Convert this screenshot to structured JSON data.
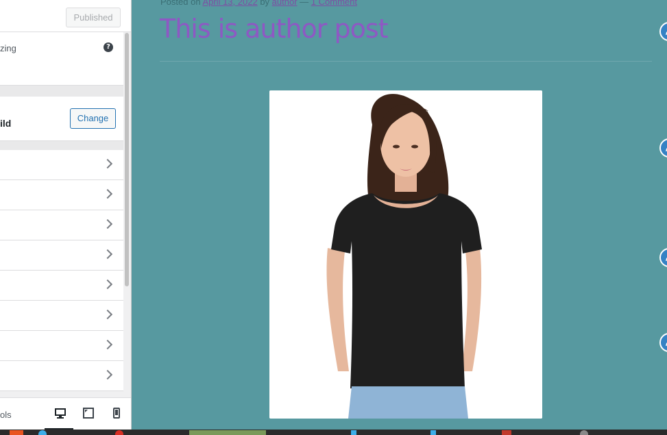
{
  "sidebar": {
    "header": {
      "published_label": "Published"
    },
    "info": {
      "text": "zing",
      "help_icon": "?"
    },
    "theme": {
      "name": "ild",
      "change_label": "Change"
    },
    "sections": [
      {},
      {},
      {},
      {},
      {},
      {},
      {},
      {}
    ],
    "footer": {
      "label": "ols"
    }
  },
  "preview": {
    "meta": {
      "prefix": "Posted on",
      "date": "April 13, 2022",
      "by": "by",
      "author": "author",
      "dash": "—",
      "comments": "1 Comment"
    },
    "title": "This is author post"
  },
  "colors": {
    "preview_background": "#5799a0",
    "title": "#8e58c4",
    "accent": "#2271b1",
    "edit_shortcut": "#3582c4"
  },
  "icons": {
    "desktop_preview": "desktop-icon",
    "tablet_preview": "tablet-icon",
    "mobile_preview": "mobile-icon",
    "edit_shortcut": "pencil-icon",
    "section_chevron": "chevron-right-icon"
  }
}
